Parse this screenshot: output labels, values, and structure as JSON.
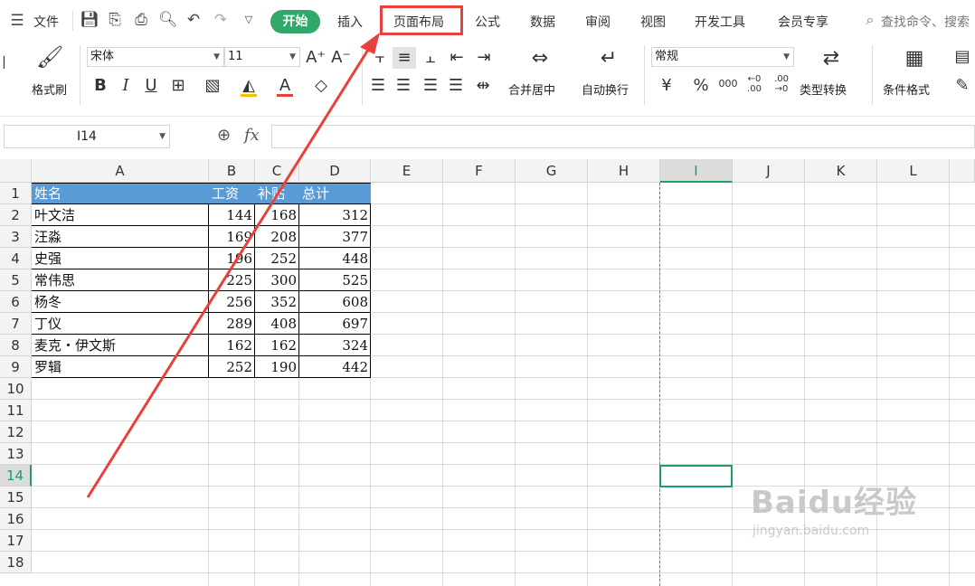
{
  "menu": {
    "file_label": "文件",
    "tabs": [
      "开始",
      "插入",
      "页面布局",
      "公式",
      "数据",
      "审阅",
      "视图",
      "开发工具",
      "会员专享"
    ],
    "search_placeholder": "查找命令、搜索"
  },
  "ribbon": {
    "format_painter": "格式刷",
    "font_name": "宋体",
    "font_size": "11",
    "number_format": "常规",
    "merge_center": "合并居中",
    "wrap_text": "自动换行",
    "type_convert": "类型转换",
    "cond_format": "条件格式"
  },
  "formula_bar": {
    "name_box": "I14",
    "fx_label": "fx",
    "formula": ""
  },
  "sheet": {
    "columns": [
      "A",
      "B",
      "C",
      "D",
      "E",
      "F",
      "G",
      "H",
      "I",
      "J",
      "K",
      "L"
    ],
    "rows": [
      "1",
      "2",
      "3",
      "4",
      "5",
      "6",
      "7",
      "8",
      "9",
      "10",
      "11",
      "12",
      "13",
      "14",
      "15",
      "16",
      "17",
      "18"
    ],
    "selected_column": "I",
    "selected_row": "14",
    "header": [
      "姓名",
      "工资",
      "补贴",
      "总计"
    ],
    "data": [
      [
        "叶文洁",
        "144",
        "168",
        "312"
      ],
      [
        "汪淼",
        "169",
        "208",
        "377"
      ],
      [
        "史强",
        "196",
        "252",
        "448"
      ],
      [
        "常伟思",
        "225",
        "300",
        "525"
      ],
      [
        "杨冬",
        "256",
        "352",
        "608"
      ],
      [
        "丁仪",
        "289",
        "408",
        "697"
      ],
      [
        "麦克・伊文斯",
        "162",
        "162",
        "324"
      ],
      [
        "罗辑",
        "252",
        "190",
        "442"
      ]
    ]
  },
  "colors": {
    "accent_green": "#2fa86a",
    "header_fill": "#5b9bd5",
    "highlight_red": "#e8403a"
  },
  "watermark": {
    "brand": "Baidu经验",
    "url": "jingyan.baidu.com"
  }
}
